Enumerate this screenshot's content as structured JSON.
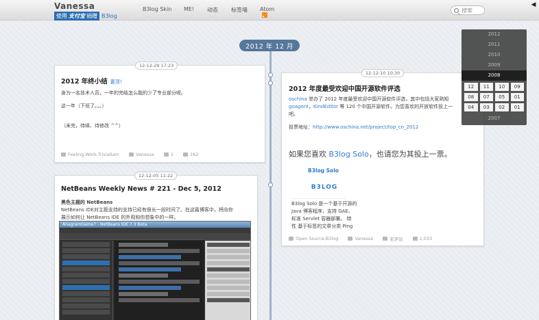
{
  "header": {
    "site_title": "Vanessa",
    "donate_use": "使用",
    "donate_alipay": "支付宝",
    "donate_give": "捐赠",
    "donate_brand": "B3log",
    "nav": [
      "B3log Skin",
      "ME!",
      "动态",
      "标签墙",
      "Atom"
    ],
    "search_placeholder": "搜索",
    "collapse_glyph": "◀"
  },
  "timeline": {
    "month_label": "2012 年 12 月"
  },
  "archive": {
    "years_top": [
      "2012",
      "2011",
      "2010",
      "2009"
    ],
    "active_year": "2008",
    "months": [
      "12",
      "11",
      "10",
      "09",
      "08",
      "07",
      "05",
      "01",
      "04",
      "03",
      "02",
      "01"
    ],
    "years_bottom": [
      "2007"
    ]
  },
  "posts": [
    {
      "date": "12-12-29 17:23",
      "title": "2012 年终小结",
      "badge": "置顶！",
      "lines": [
        "身为一名技术人员，一年的完结怎么能的少了专业部分呢。",
        "这一年（下班了。。。）",
        "",
        "（未完，待续、待修改 ^^）"
      ],
      "tags": "Feeling,Work,TrivialIam",
      "author": "Vanessa",
      "comments": "1",
      "views": "162"
    },
    {
      "date": "12-12-10 10:30",
      "title": "2012 年度最受欢迎中国开源软件评选",
      "intro_link1": "oschina",
      "intro_text1": " 举办了 2012 年度最受欢迎中国开源软件评选，其中包括大家熟知",
      "intro_link2": "goagent",
      "intro_sep": "，",
      "intro_link3": "KindEditor",
      "intro_text2": " 等 120 个中国开源软件。为您喜欢的开放软件投上一",
      "intro_text3": "吧。",
      "vote_label": "投票地址：",
      "vote_url": "http://www.oschina.net/project/top_cn_2012",
      "callout_pre": "如果您喜欢 ",
      "callout_link": "B3log Solo",
      "callout_post": "，也请您为其投上一票。",
      "product_name": "B3log Solo",
      "product_logo": "B3LOG",
      "product_desc": [
        "B3log Solo 是一个基于开源的",
        "Java 博客程序，支持 GAE、",
        "标准 Servlet 容器部署。  特",
        "性 基于标签的文章分类 Ping"
      ],
      "tags": "Open Source,B3log",
      "author": "Vanessa",
      "comments": "无评论",
      "views": "1,033"
    },
    {
      "date": "12-12-05 11:22",
      "title": "NetBeans Weekly News # 221 - Dec 5, 2012",
      "subheading": "黑色主题的 NetBeans",
      "lines": [
        "NetBeans IDE对主题支持的支持已经有很长一段时间了。在这篇博客中，将向你",
        "展示如何让 NetBeans IDE 的外观和你想象中的一样。"
      ],
      "screenshot_title": "AnagramGame7 - NetBeans IDE 7.3 Beta"
    }
  ],
  "colors": {
    "accent": "#2e7bcf",
    "month_pill": "#55779a",
    "timeline": "#9fb3c5",
    "archive_bg": "#373737"
  }
}
